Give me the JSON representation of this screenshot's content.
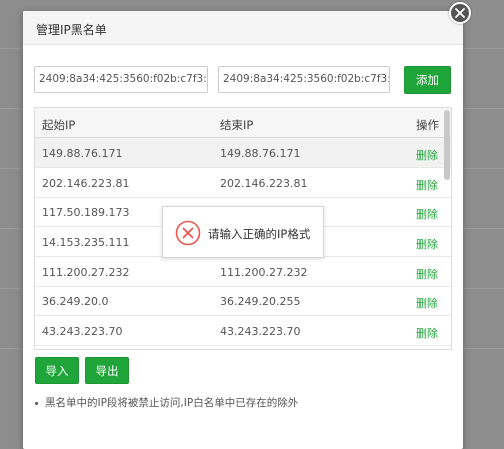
{
  "dialog": {
    "title": "管理IP黑名单"
  },
  "form": {
    "start_ip_value": "2409:8a34:425:3560:f02b:c7f3:3293:",
    "end_ip_value": "2409:8a34:425:3560:f02b:c7f3:3293:",
    "add_label": "添加"
  },
  "table": {
    "headers": [
      "起始IP",
      "结束IP",
      "操作"
    ],
    "rows": [
      {
        "start": "149.88.76.171",
        "end": "149.88.76.171",
        "action": "删除"
      },
      {
        "start": "202.146.223.81",
        "end": "202.146.223.81",
        "action": "删除"
      },
      {
        "start": "117.50.189.173",
        "end": "",
        "action": "删除"
      },
      {
        "start": "14.153.235.111",
        "end": "",
        "action": "删除"
      },
      {
        "start": "111.200.27.232",
        "end": "111.200.27.232",
        "action": "删除"
      },
      {
        "start": "36.249.20.0",
        "end": "36.249.20.255",
        "action": "删除"
      },
      {
        "start": "43.243.223.70",
        "end": "43.243.223.70",
        "action": "删除"
      }
    ]
  },
  "buttons": {
    "import_label": "导入",
    "export_label": "导出"
  },
  "note": "黑名单中的IP段将被禁止访问,IP白名单中已存在的除外",
  "toast": {
    "message": "请输入正确的IP格式",
    "icon": "error-circle-x-icon",
    "color": "#e8574f"
  },
  "colors": {
    "accent_green": "#20a53a"
  }
}
